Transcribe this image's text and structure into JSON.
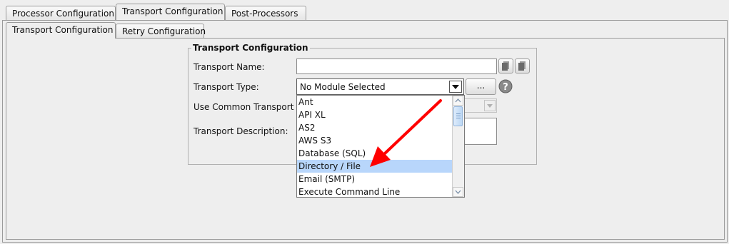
{
  "top_tabs": [
    {
      "label": "Processor Configuration",
      "active": false
    },
    {
      "label": "Transport Configuration",
      "active": true
    },
    {
      "label": "Post-Processors",
      "active": false
    }
  ],
  "sub_tabs": [
    {
      "label": "Transport Configuration",
      "active": true
    },
    {
      "label": "Retry Configuration",
      "active": false
    }
  ],
  "group": {
    "title": "Transport Configuration",
    "transport_name_label": "Transport Name:",
    "transport_name_value": "",
    "transport_type_label": "Transport Type:",
    "transport_type_selected": "No Module Selected",
    "browse_label": "...",
    "use_common_label": "Use Common Transport",
    "description_label": "Transport Description:"
  },
  "dropdown": {
    "options": [
      "Ant",
      "API XL",
      "AS2",
      "AWS S3",
      "Database (SQL)",
      "Directory / File",
      "Email (SMTP)",
      "Execute Command Line"
    ],
    "highlighted": "Directory / File"
  },
  "icons": [
    "copy-icon",
    "paste-icon",
    "help-icon",
    "dropdown-arrow-icon",
    "annotation-arrow"
  ],
  "colors": {
    "highlight": "#b8d6fb",
    "annotation_arrow": "#ff0000"
  }
}
